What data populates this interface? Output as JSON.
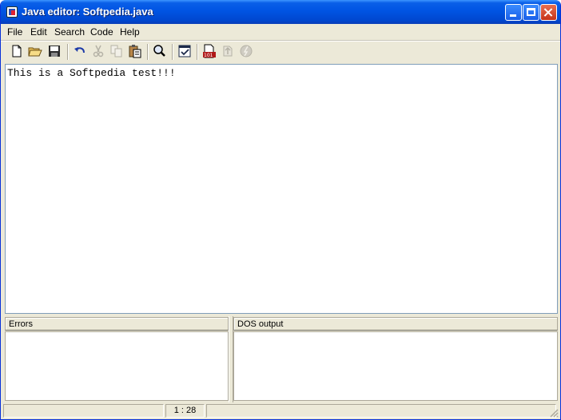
{
  "window": {
    "title": "Java editor: Softpedia.java"
  },
  "menu": [
    {
      "label": "File"
    },
    {
      "label": "Edit"
    },
    {
      "label": "Search"
    },
    {
      "label": "Code"
    },
    {
      "label": "Help"
    }
  ],
  "toolbar": [
    {
      "icon": "new-file-icon",
      "enabled": true
    },
    {
      "icon": "open-folder-icon",
      "enabled": true
    },
    {
      "icon": "save-icon",
      "enabled": true
    },
    {
      "icon": "undo-icon",
      "enabled": true
    },
    {
      "icon": "cut-icon",
      "enabled": false
    },
    {
      "icon": "copy-icon",
      "enabled": false
    },
    {
      "icon": "paste-icon",
      "enabled": true
    },
    {
      "icon": "find-icon",
      "enabled": true
    },
    {
      "icon": "check-syntax-icon",
      "enabled": true
    },
    {
      "icon": "compile-icon",
      "enabled": true
    },
    {
      "icon": "build-icon",
      "enabled": false
    },
    {
      "icon": "run-icon",
      "enabled": false
    }
  ],
  "editor": {
    "content": "This is a Softpedia test!!!"
  },
  "panels": {
    "errors_title": "Errors",
    "dos_output_title": "DOS output"
  },
  "status": {
    "cursor_position": "1 : 28"
  },
  "colors": {
    "titlebar": "#0054e3",
    "chrome": "#ece9d8",
    "editor_border": "#7f9db9",
    "close_button": "#c5331a"
  }
}
